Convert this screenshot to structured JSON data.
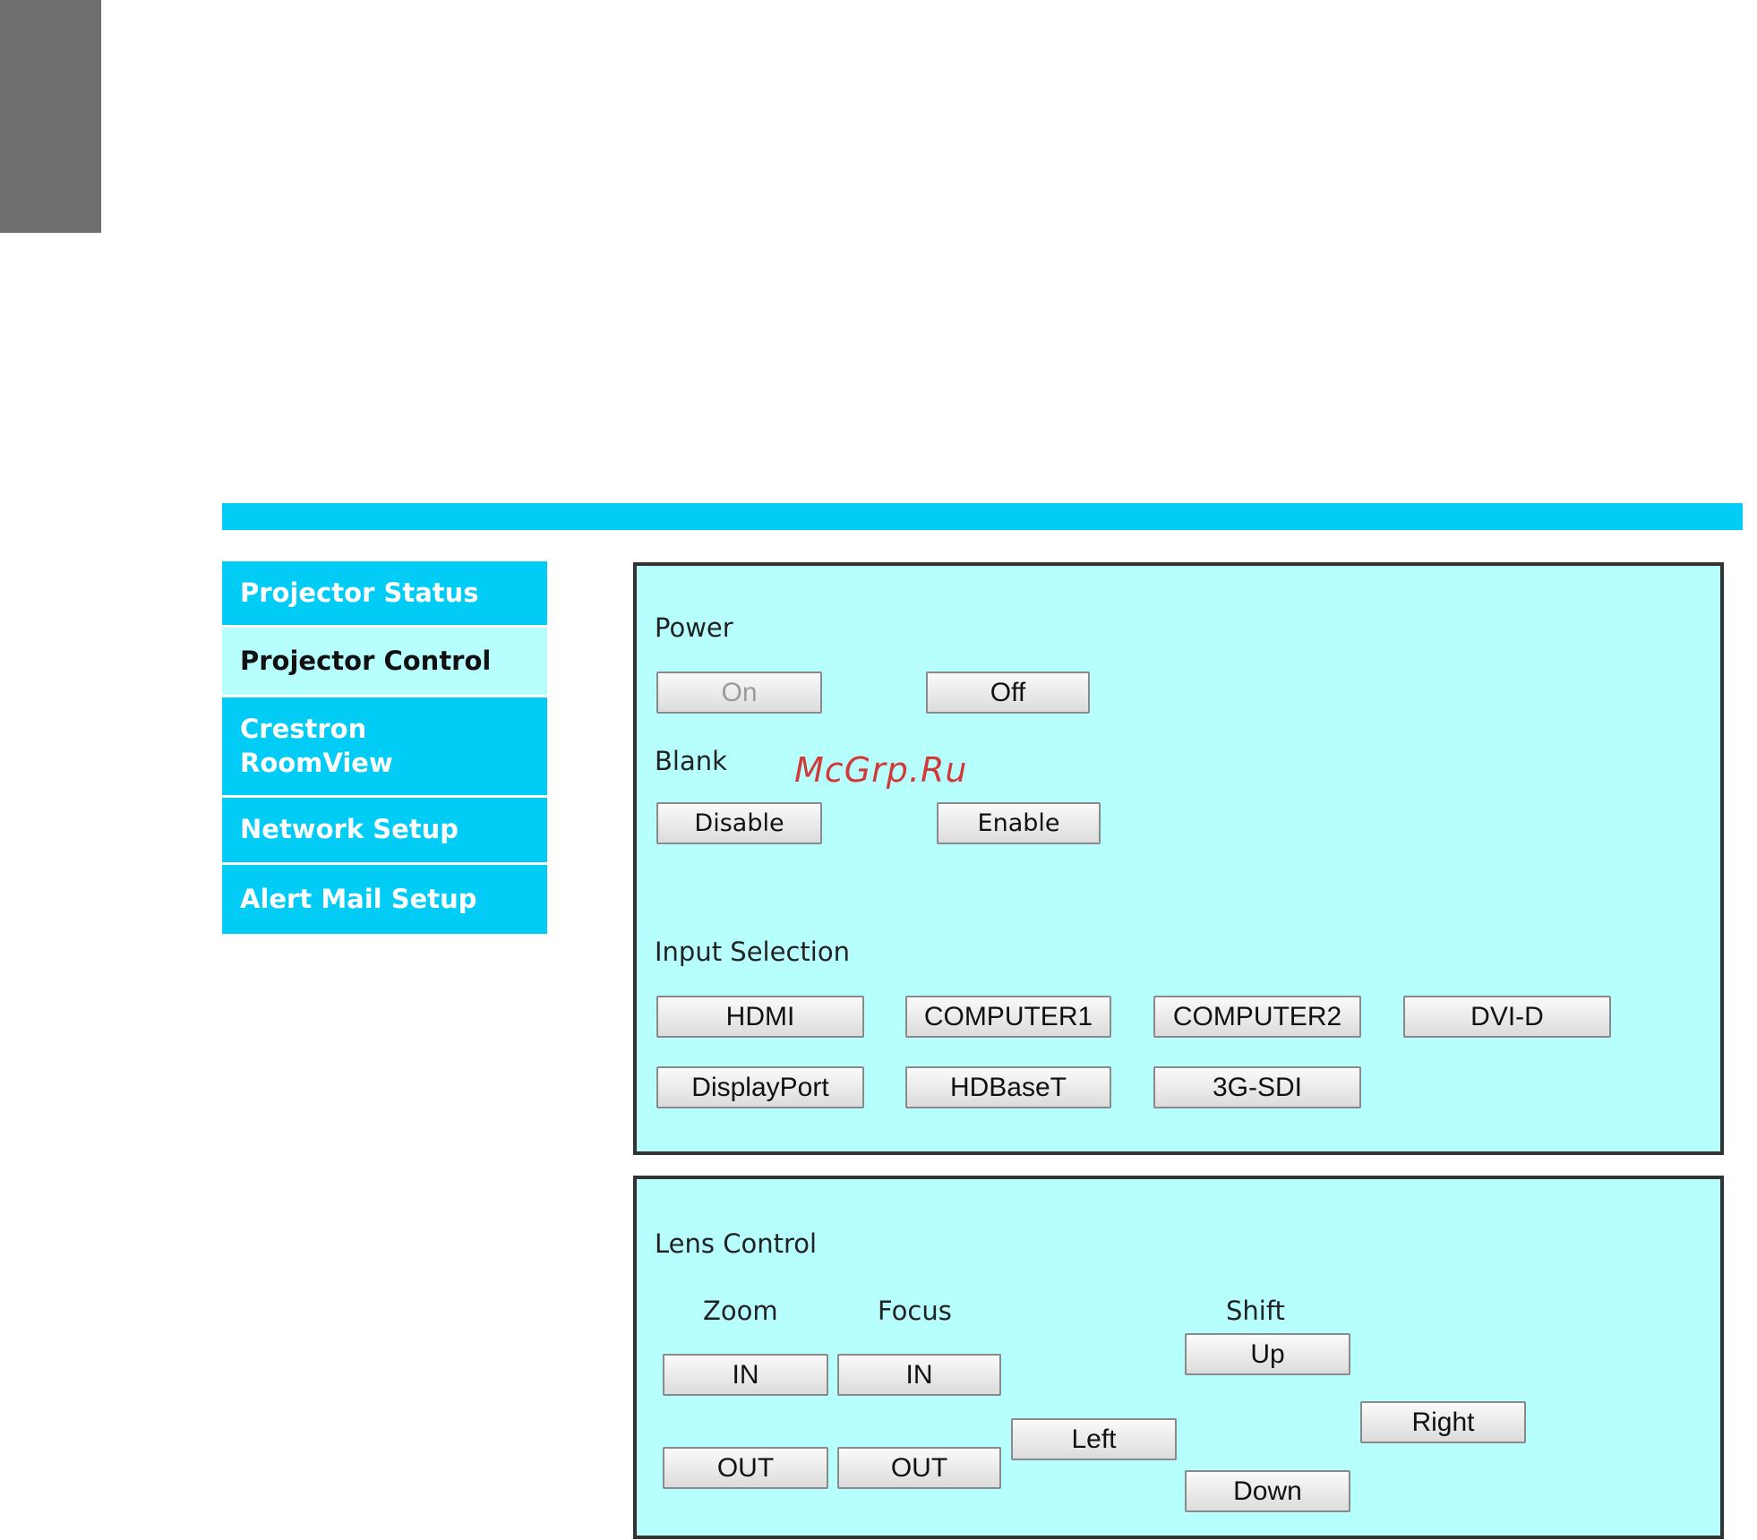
{
  "nav": {
    "items": [
      {
        "label": "Projector Status"
      },
      {
        "label": "Projector Control"
      },
      {
        "label": "Crestron RoomView"
      },
      {
        "label": "Network Setup"
      },
      {
        "label": "Alert Mail Setup"
      }
    ],
    "active": "Projector Control"
  },
  "power": {
    "label": "Power",
    "on": "On",
    "off": "Off"
  },
  "blank": {
    "label": "Blank",
    "disable": "Disable",
    "enable": "Enable"
  },
  "input": {
    "label": "Input Selection",
    "buttons": [
      "HDMI",
      "COMPUTER1",
      "COMPUTER2",
      "DVI-D",
      "DisplayPort",
      "HDBaseT",
      "3G-SDI"
    ]
  },
  "lens": {
    "label": "Lens Control",
    "zoom": {
      "label": "Zoom",
      "in": "IN",
      "out": "OUT"
    },
    "focus": {
      "label": "Focus",
      "in": "IN",
      "out": "OUT"
    },
    "shift": {
      "label": "Shift",
      "up": "Up",
      "down": "Down",
      "left": "Left",
      "right": "Right"
    }
  },
  "watermark": "McGrp.Ru",
  "colors": {
    "nav": "#00ccf5",
    "panel": "#b7fefe",
    "active_nav": "#b7fefe",
    "watermark": "#d23a3a"
  }
}
